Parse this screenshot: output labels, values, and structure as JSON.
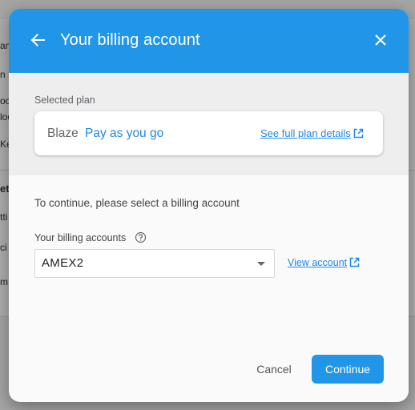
{
  "dialog": {
    "title": "Your billing account",
    "back_icon": "arrow-back-icon",
    "close_icon": "close-icon"
  },
  "plan": {
    "section_label": "Selected plan",
    "name": "Blaze",
    "type": "Pay as you go",
    "details_link": "See full plan details"
  },
  "billing": {
    "instruction": "To continue, please select a billing account",
    "accounts_label": "Your billing accounts",
    "selected_account": "AMEX2",
    "view_link": "View account"
  },
  "actions": {
    "cancel_label": "Cancel",
    "continue_label": "Continue"
  },
  "background": {
    "fragments": [
      "am",
      "n",
      "oo",
      "loo",
      "Ke",
      "ett",
      "tti",
      "ci",
      "m"
    ]
  },
  "colors": {
    "accent": "#2196e8",
    "link": "#1e88e5",
    "plan_section_bg": "#eeeeee",
    "dialog_bg": "#fafafa"
  }
}
